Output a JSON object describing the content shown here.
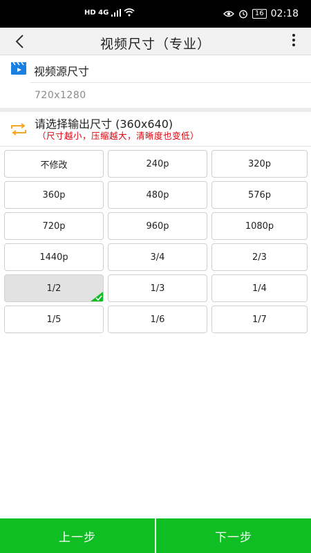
{
  "status_bar": {
    "network": "HD 4G",
    "battery": "16",
    "time": "02:18"
  },
  "toolbar": {
    "title": "视频尺寸（专业）"
  },
  "source": {
    "label": "视频源尺寸",
    "value": "720x1280"
  },
  "output": {
    "label": "请选择输出尺寸 (360x640)",
    "note": "（尺寸越小，压缩越大，清晰度也变低）"
  },
  "size_options": [
    {
      "label": "不修改",
      "selected": false
    },
    {
      "label": "240p",
      "selected": false
    },
    {
      "label": "320p",
      "selected": false
    },
    {
      "label": "360p",
      "selected": false
    },
    {
      "label": "480p",
      "selected": false
    },
    {
      "label": "576p",
      "selected": false
    },
    {
      "label": "720p",
      "selected": false
    },
    {
      "label": "960p",
      "selected": false
    },
    {
      "label": "1080p",
      "selected": false
    },
    {
      "label": "1440p",
      "selected": false
    },
    {
      "label": "3/4",
      "selected": false
    },
    {
      "label": "2/3",
      "selected": false
    },
    {
      "label": "1/2",
      "selected": true
    },
    {
      "label": "1/3",
      "selected": false
    },
    {
      "label": "1/4",
      "selected": false
    },
    {
      "label": "1/5",
      "selected": false
    },
    {
      "label": "1/6",
      "selected": false
    },
    {
      "label": "1/7",
      "selected": false
    }
  ],
  "bottom": {
    "prev_label": "上一步",
    "next_label": "下一步"
  },
  "colors": {
    "accent_green": "#0fbe23",
    "warning_red": "#e0000c",
    "source_icon_blue": "#1a7fe0",
    "output_icon_orange": "#f5a623"
  },
  "icons": {
    "back": "chevron-left-icon",
    "more": "more-vertical-icon",
    "source": "video-clapper-icon",
    "output": "swap-arrows-icon",
    "selected": "checkmark-icon"
  }
}
